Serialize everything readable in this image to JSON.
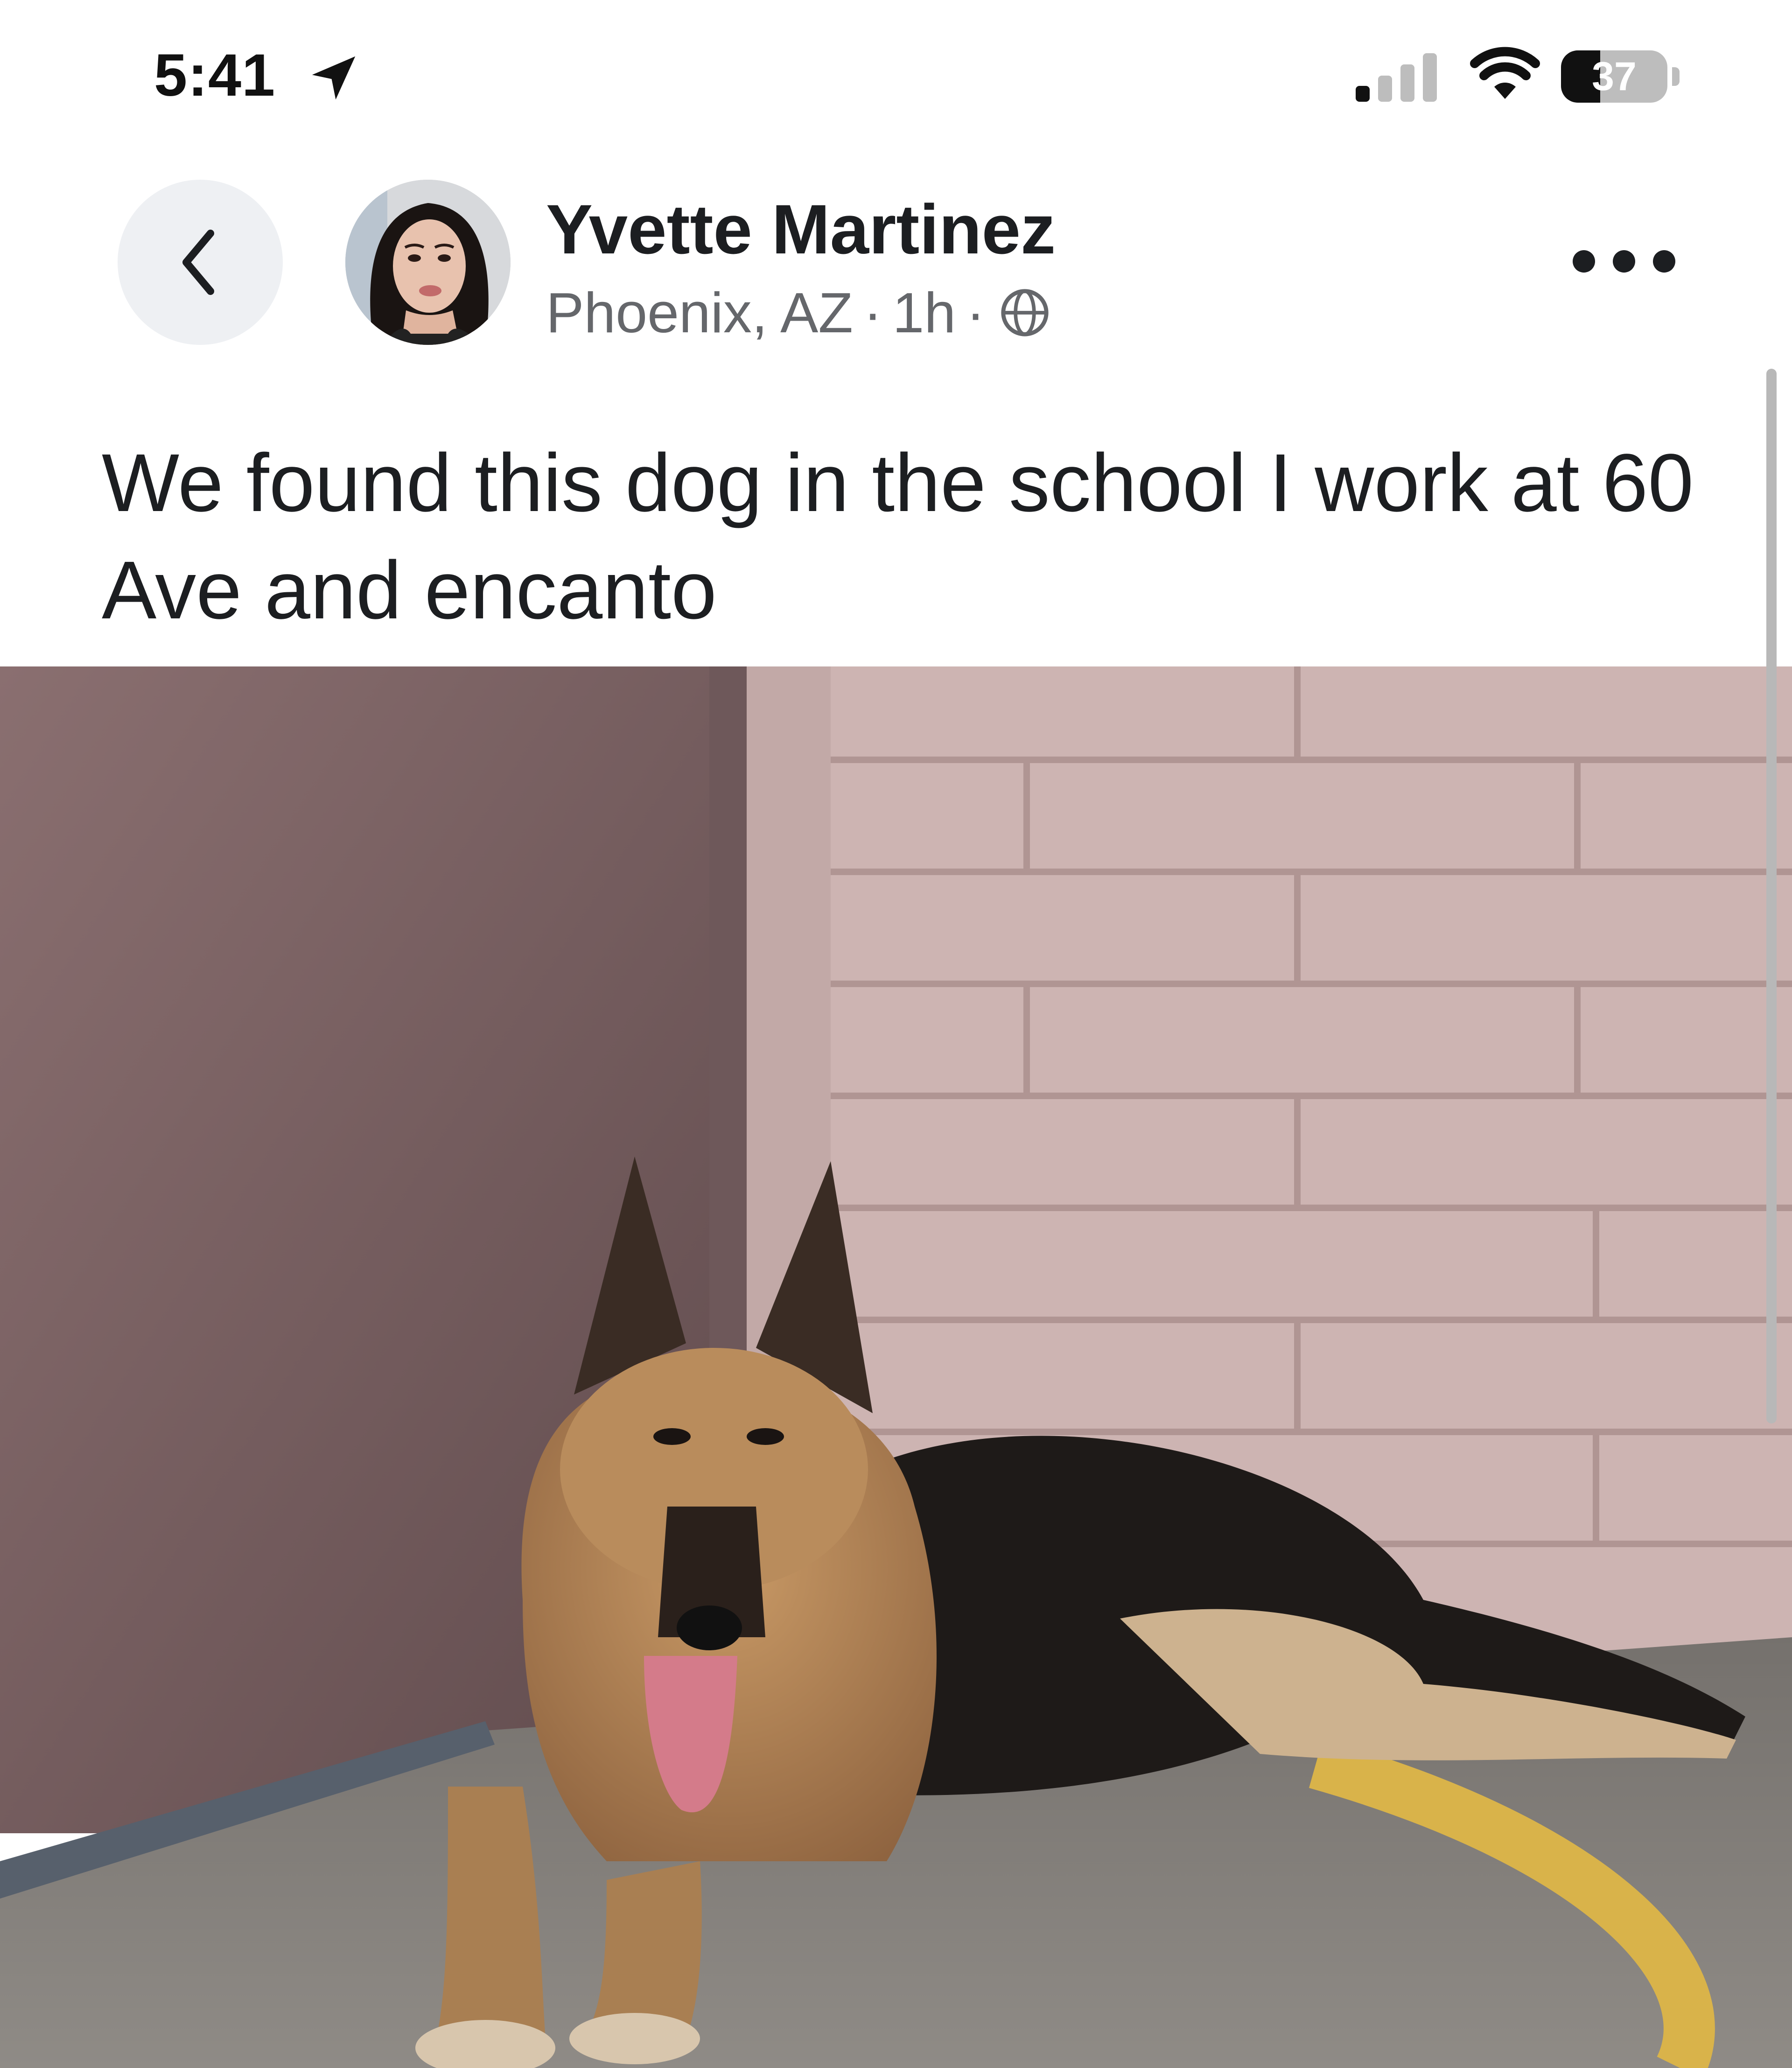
{
  "status_bar": {
    "time": "5:41",
    "battery_percent": "37",
    "battery_level": 0.37,
    "signal_bars_active": 1,
    "icons": [
      "location-arrow-icon",
      "signal-icon",
      "wifi-icon",
      "battery-icon"
    ]
  },
  "post": {
    "author": "Yvette Martinez",
    "location": "Phoenix, AZ",
    "time_ago": "1h",
    "separator": "·",
    "audience_icon": "globe-icon",
    "text": "We found this dog in the school I work at 60 Ave and encanto",
    "photo_subject": "german-shepherd-dog"
  },
  "nav": {
    "back_icon": "chevron-left-icon",
    "more_icon": "more-horizontal-icon"
  },
  "colors": {
    "text_primary": "#1c1e21",
    "text_secondary": "#65676b",
    "back_button_bg": "#eef0f3"
  }
}
